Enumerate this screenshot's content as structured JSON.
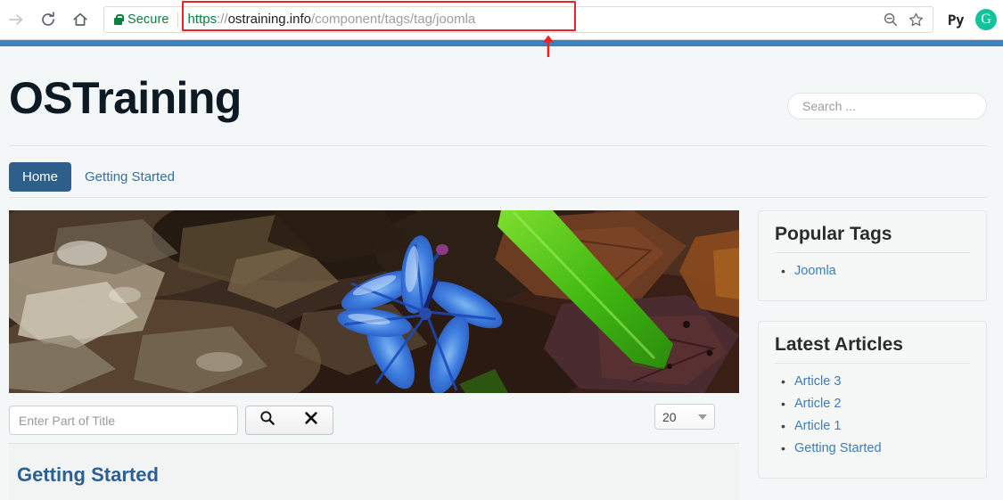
{
  "browser": {
    "nav": {
      "forward_icon": "forward-arrow-icon",
      "reload_icon": "reload-icon",
      "home_icon": "home-icon"
    },
    "omnibox": {
      "secure_label": "Secure",
      "lock_icon": "lock-icon",
      "url_full": "https://ostraining.info/component/tags/tag/joomla",
      "url_scheme": "https",
      "url_separator": "://",
      "url_host": "ostraining.info",
      "url_path": "/component/tags/tag/joomla",
      "zoom_out_icon": "zoom-out-icon",
      "bookmark_icon": "star-icon"
    },
    "extensions": [
      {
        "name": "py-extension-icon",
        "label": "Py"
      },
      {
        "name": "grammarly-icon",
        "label": "G"
      }
    ],
    "annotation": {
      "highlight_color": "#ee2222",
      "arrow_icon": "red-arrow-up-icon"
    }
  },
  "site": {
    "topbar_color": "#3983c3",
    "accent_color": "#2e5f8a",
    "link_color": "#3d7cb5",
    "title": "OSTraining",
    "search": {
      "placeholder": "Search ...",
      "value": ""
    },
    "nav": [
      {
        "label": "Home",
        "active": true
      },
      {
        "label": "Getting Started",
        "active": false
      }
    ],
    "hero": {
      "alt": "Blue scilla flower on forest floor with dried leaves and a green leaf"
    },
    "filter": {
      "placeholder": "Enter Part of Title",
      "value": "",
      "search_icon": "magnifier-icon",
      "clear_icon": "x-icon",
      "limit_value": "20",
      "limit_caret_icon": "chevron-down-icon"
    },
    "results": [
      {
        "title": "Getting Started"
      }
    ],
    "sidebar": [
      {
        "title": "Popular Tags",
        "items": [
          "Joomla"
        ]
      },
      {
        "title": "Latest Articles",
        "items": [
          "Article 3",
          "Article 2",
          "Article 1",
          "Getting Started"
        ]
      }
    ]
  }
}
